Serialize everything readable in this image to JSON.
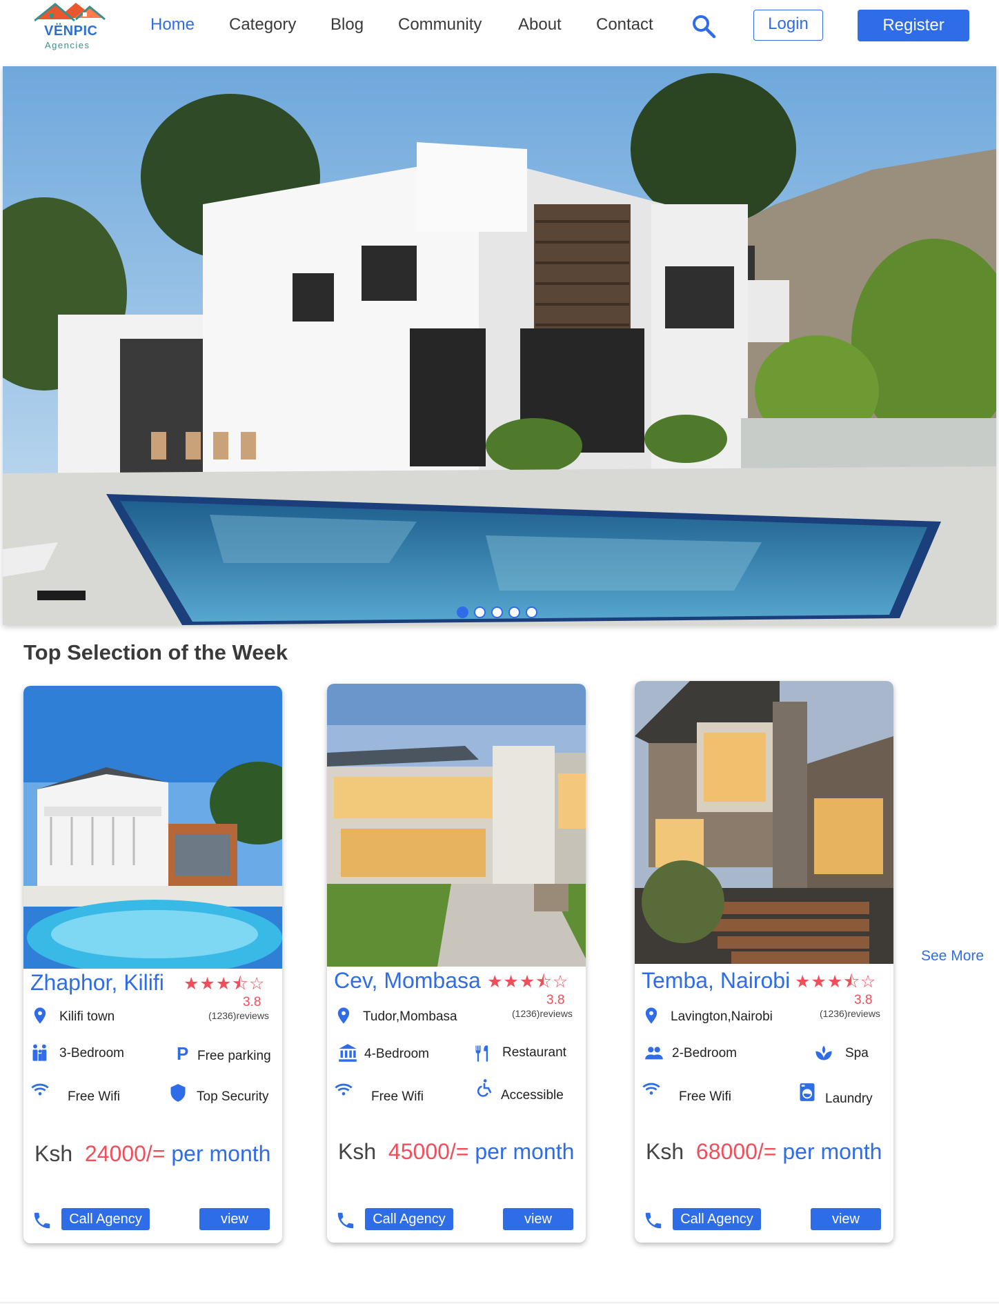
{
  "brand": {
    "name": "VËNPIC",
    "tagline": "Agencies",
    "colors": {
      "roof": "#e8572f",
      "text": "#2c6fcf",
      "tag": "#3a8f8a"
    }
  },
  "nav": {
    "items": [
      {
        "label": "Home",
        "active": true
      },
      {
        "label": "Category",
        "active": false
      },
      {
        "label": "Blog",
        "active": false
      },
      {
        "label": "Community",
        "active": false
      },
      {
        "label": "About",
        "active": false
      },
      {
        "label": "Contact",
        "active": false
      }
    ],
    "search_icon": "search-icon",
    "login_label": "Login",
    "register_label": "Register"
  },
  "hero": {
    "slides": 5,
    "active_slide": 1
  },
  "section": {
    "title": "Top Selection of the Week",
    "see_more": "See More"
  },
  "listings": [
    {
      "title": "Zhaphor, Kilifi",
      "stars": "★★★⯪☆",
      "rating": "3.8",
      "reviews": "(1236)reviews",
      "location": "Kilifi town",
      "features": [
        {
          "icon": "family-icon",
          "label": "3-Bedroom"
        },
        {
          "icon": "parking-icon",
          "label": "Free parking"
        },
        {
          "icon": "wifi-icon",
          "label": "Free Wifi"
        },
        {
          "icon": "shield-icon",
          "label": "Top Security"
        }
      ],
      "price": {
        "currency": "Ksh",
        "amount": "24000/=",
        "period": "per month"
      },
      "call_label": "Call Agency",
      "view_label": "view"
    },
    {
      "title": "Cev, Mombasa",
      "stars": "★★★⯪☆",
      "rating": "3.8",
      "reviews": "(1236)reviews",
      "location": "Tudor,Mombasa",
      "features": [
        {
          "icon": "bank-icon",
          "label": "4-Bedroom"
        },
        {
          "icon": "restaurant-icon",
          "label": "Restaurant"
        },
        {
          "icon": "wifi-icon",
          "label": "Free Wifi"
        },
        {
          "icon": "accessible-icon",
          "label": "Accessible"
        }
      ],
      "price": {
        "currency": "Ksh",
        "amount": "45000/=",
        "period": "per month"
      },
      "call_label": "Call Agency",
      "view_label": "view"
    },
    {
      "title": "Temba, Nairobi",
      "stars": "★★★⯪☆",
      "rating": "3.8",
      "reviews": "(1236)reviews",
      "location": "Lavington,Nairobi",
      "features": [
        {
          "icon": "people-icon",
          "label": "2-Bedroom"
        },
        {
          "icon": "spa-icon",
          "label": "Spa"
        },
        {
          "icon": "wifi-icon",
          "label": "Free Wifi"
        },
        {
          "icon": "laundry-icon",
          "label": "Laundry"
        }
      ],
      "price": {
        "currency": "Ksh",
        "amount": "68000/=",
        "period": "per month"
      },
      "call_label": "Call Agency",
      "view_label": "view"
    }
  ],
  "colors": {
    "primary": "#2f6ce8",
    "accent": "#f04e5a"
  }
}
